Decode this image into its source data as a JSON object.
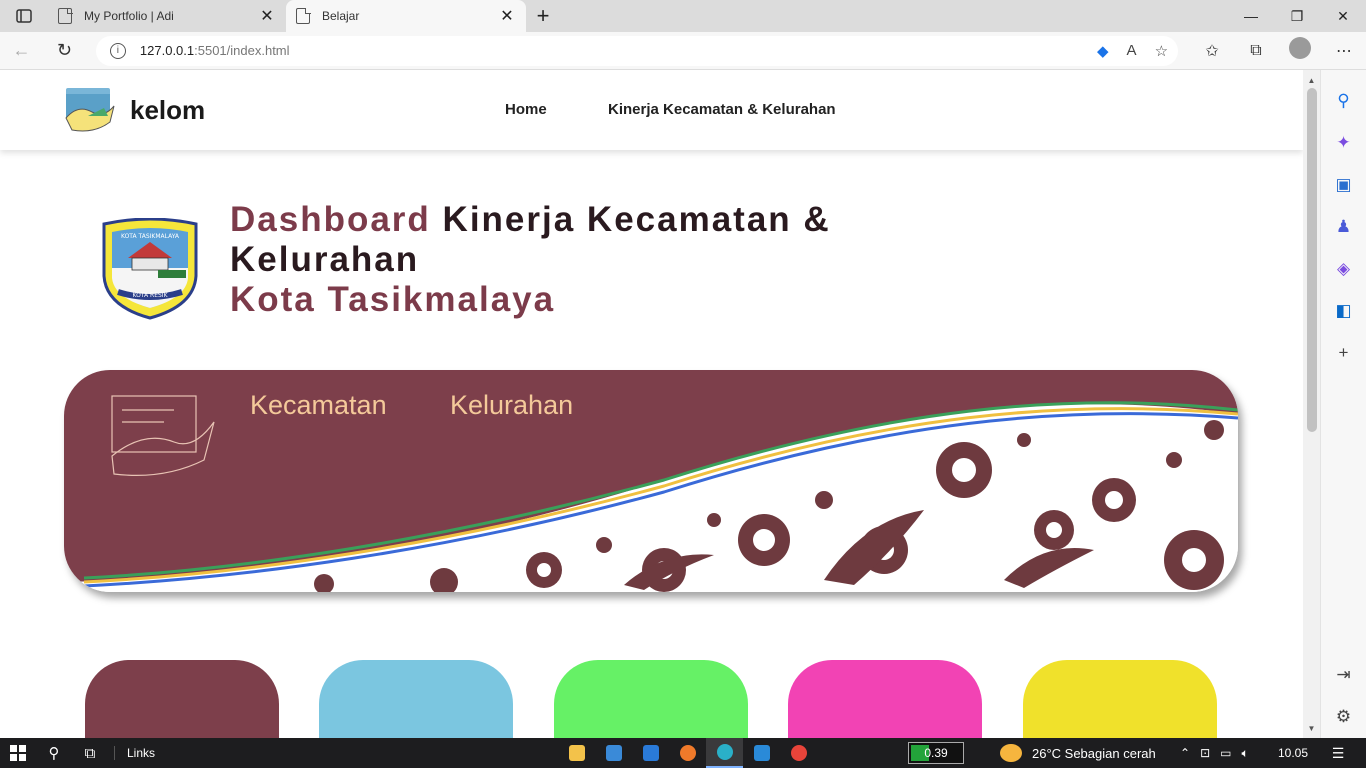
{
  "browser": {
    "tabs": [
      {
        "title": "My Portfolio | Adi",
        "close": "✕",
        "active": false
      },
      {
        "title": "Belajar",
        "close": "✕",
        "active": true
      }
    ],
    "new_tab": "+",
    "url_host": "127.0.0.1",
    "url_path": ":5501/index.html",
    "window_controls": {
      "minimize": "—",
      "maximize": "❐",
      "close": "✕"
    }
  },
  "site": {
    "brand": "kelom",
    "nav": [
      "Home",
      "Kinerja Kecamatan & Kelurahan"
    ],
    "title_part1": "Dashboard",
    "title_part2": "Kinerja Kecamatan & Kelurahan",
    "title_part3": "Kota Tasikmalaya",
    "crest_text_top": "KOTA TASIKMALAYA",
    "crest_text_bottom": "KOTA RESIK",
    "banner_tabs": [
      "Kecamatan",
      "Kelurahan"
    ],
    "cards": [
      {
        "color": "#7d3f4b"
      },
      {
        "color": "#7bc6e0"
      },
      {
        "color": "#66f166"
      },
      {
        "color": "#f243b4"
      },
      {
        "color": "#f0e12b"
      }
    ],
    "colors": {
      "maroon": "#7c3b4a",
      "accent_text": "#f4c99a"
    }
  },
  "taskbar": {
    "links": "Links",
    "perf_value": "0.39",
    "weather": "26°C  Sebagian cerah",
    "clock": "10.05"
  }
}
